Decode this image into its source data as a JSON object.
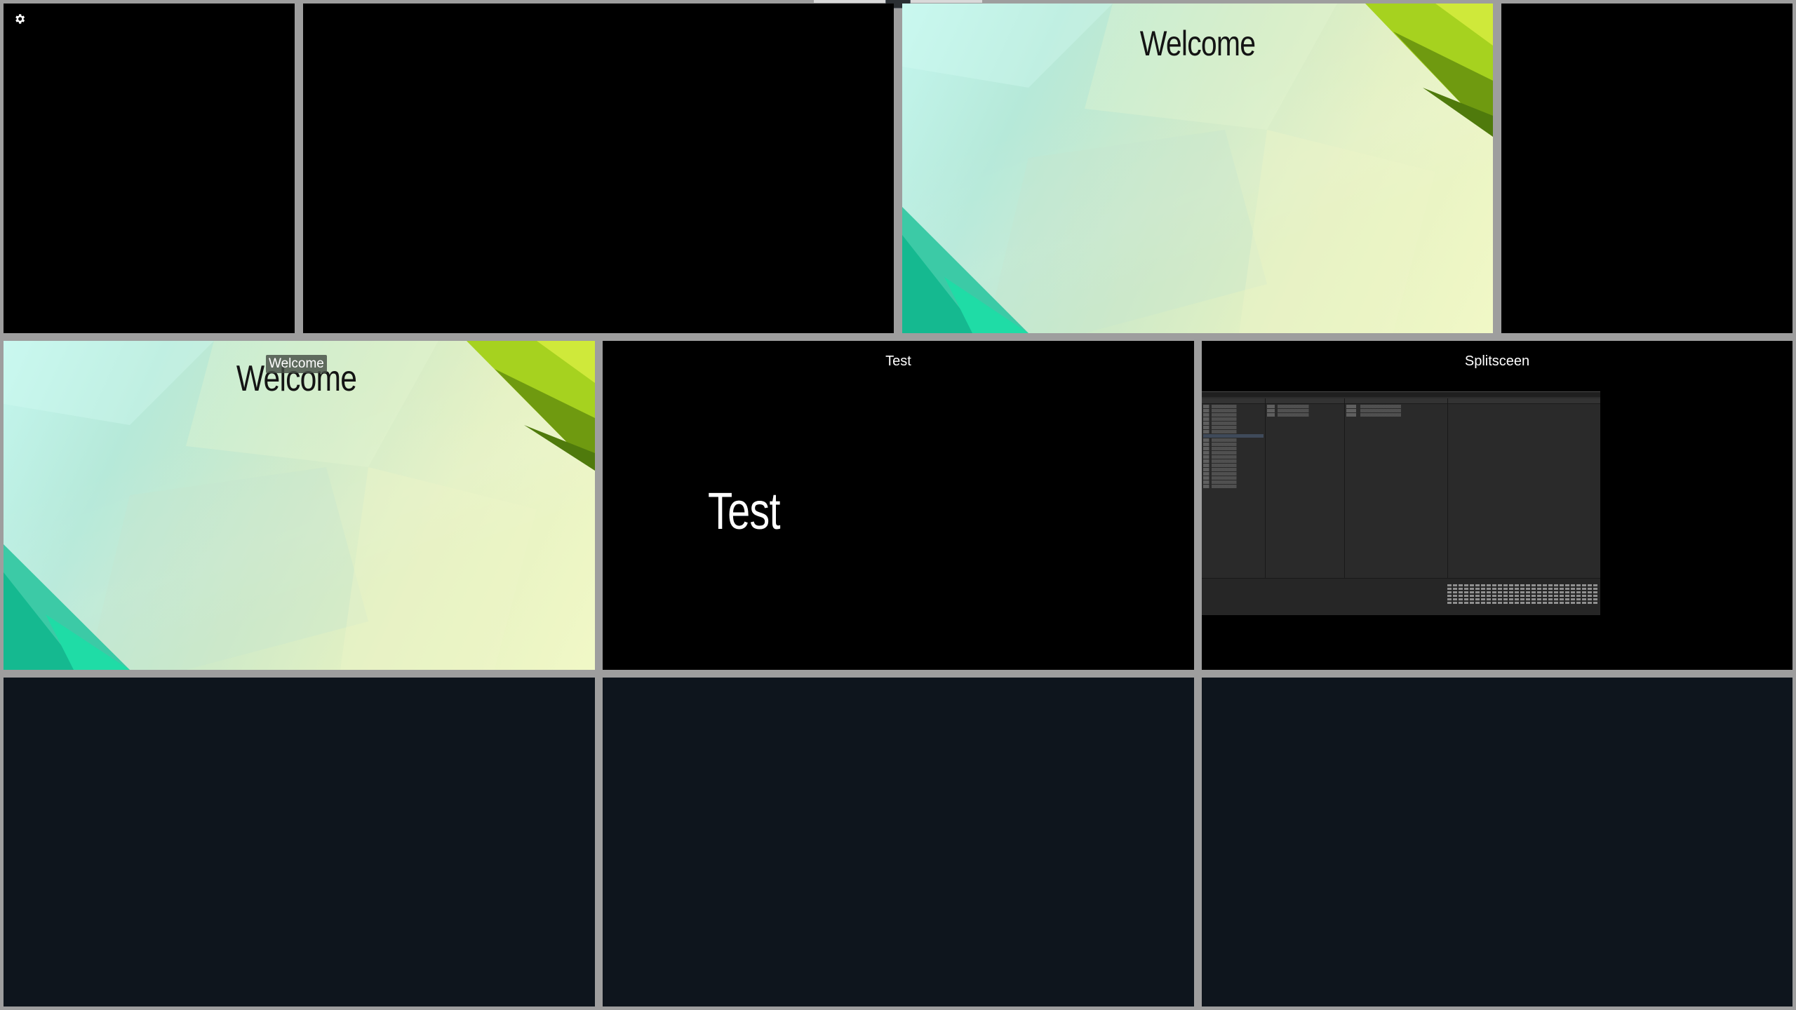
{
  "top_bar": {
    "settings_icon": "gear-icon"
  },
  "tiles": {
    "row1_welcome_slide": {
      "title": "Welcome"
    },
    "row2_welcome_slide": {
      "overlay_label": "Welcome",
      "title": "Welcome"
    },
    "row2_test": {
      "caption": "Test",
      "content_text": "Test"
    },
    "row2_splitscreen": {
      "caption": "Splitsceen"
    }
  },
  "colors": {
    "background": "#9e9e9e",
    "tile_black": "#000000",
    "tile_navy": "#0e151d",
    "accent_green": "#8fc31f",
    "accent_teal": "#1fcf9a"
  }
}
